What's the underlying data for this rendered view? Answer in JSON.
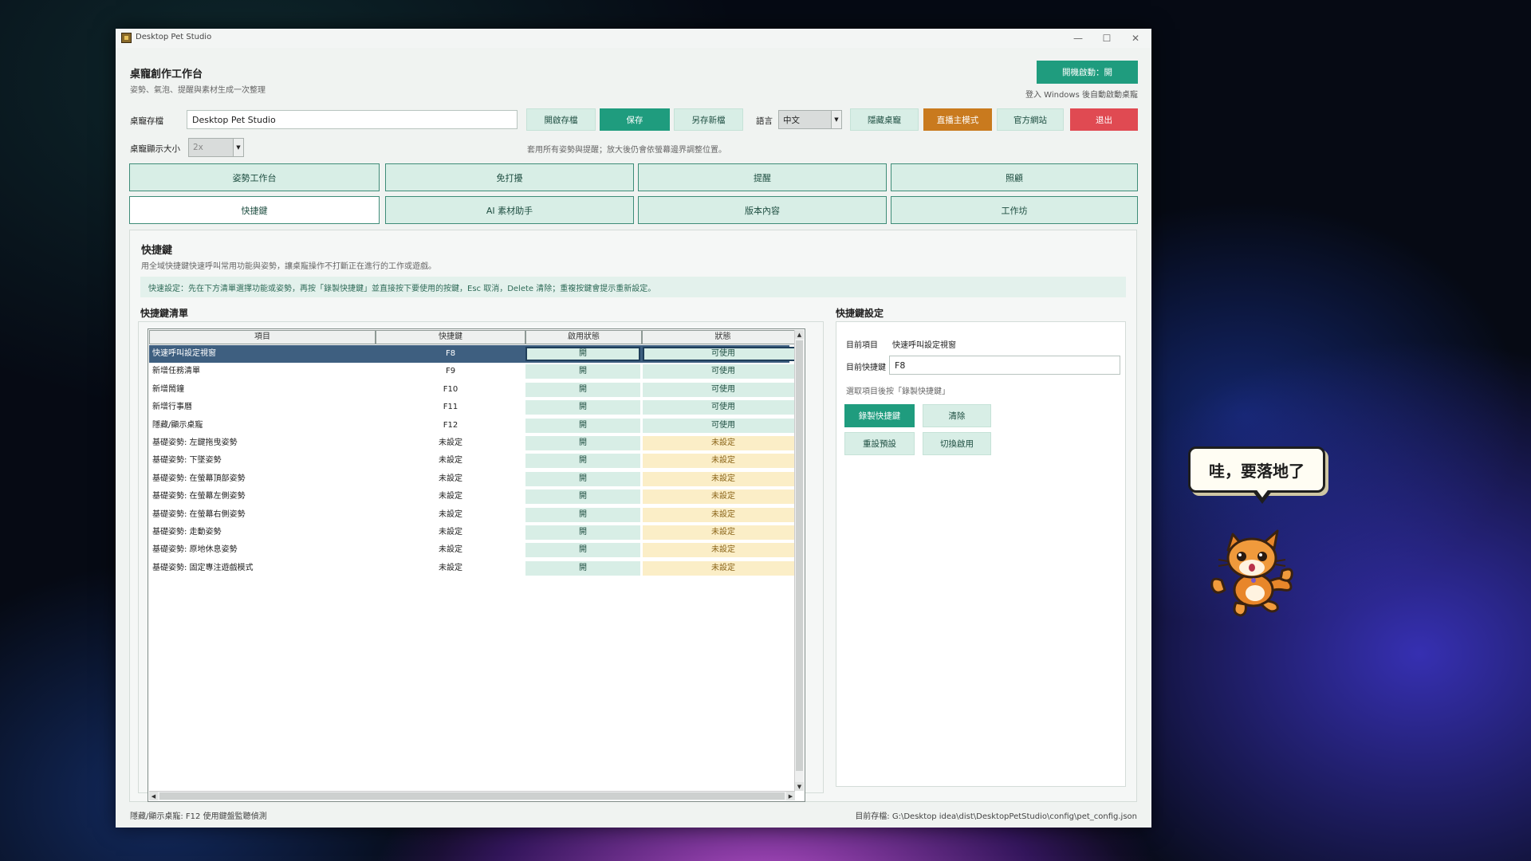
{
  "window": {
    "title": "Desktop Pet Studio"
  },
  "header": {
    "title": "桌寵創作工作台",
    "subtitle": "姿勢、氣泡、提醒與素材生成一次整理",
    "autostart_label": "開機啟動：開",
    "autostart_hint": "登入 Windows 後自動啟動桌寵"
  },
  "toolbar": {
    "profile_label": "桌寵存檔",
    "profile_value": "Desktop Pet Studio",
    "open_label": "開啟存檔",
    "save_label": "保存",
    "save_as_label": "另存新檔",
    "language_label": "語言",
    "language_value": "中文",
    "hide_label": "隱藏桌寵",
    "streamer_label": "直播主模式",
    "website_label": "官方網站",
    "exit_label": "退出",
    "size_label": "桌寵顯示大小",
    "size_value": "2x",
    "size_hint": "套用所有姿勢與提醒；放大後仍會依螢幕邊界調整位置。"
  },
  "tabs": [
    {
      "label": "姿勢工作台"
    },
    {
      "label": "免打擾"
    },
    {
      "label": "提醒"
    },
    {
      "label": "照顧"
    },
    {
      "label": "快捷鍵"
    },
    {
      "label": "AI 素材助手"
    },
    {
      "label": "版本內容"
    },
    {
      "label": "工作坊"
    }
  ],
  "hotkeys": {
    "title": "快捷鍵",
    "description": "用全域快捷鍵快速呼叫常用功能與姿勢，讓桌寵操作不打斷正在進行的工作或遊戲。",
    "hint": "快速設定：先在下方清單選擇功能或姿勢，再按「錄製快捷鍵」並直接按下要使用的按鍵，Esc 取消，Delete 清除；重複按鍵會提示重新設定。",
    "list_title": "快捷鍵清單",
    "columns": [
      "項目",
      "快捷鍵",
      "啟用狀態",
      "狀態"
    ],
    "rows": [
      {
        "name": "快速呼叫設定視窗",
        "key": "F8",
        "enabled": "開",
        "status": "可使用",
        "ok": true
      },
      {
        "name": "新增任務清單",
        "key": "F9",
        "enabled": "開",
        "status": "可使用",
        "ok": true
      },
      {
        "name": "新增鬧鐘",
        "key": "F10",
        "enabled": "開",
        "status": "可使用",
        "ok": true
      },
      {
        "name": "新增行事曆",
        "key": "F11",
        "enabled": "開",
        "status": "可使用",
        "ok": true
      },
      {
        "name": "隱藏/顯示桌寵",
        "key": "F12",
        "enabled": "開",
        "status": "可使用",
        "ok": true
      },
      {
        "name": "基礎姿勢: 左鍵拖曳姿勢",
        "key": "未設定",
        "enabled": "開",
        "status": "未設定",
        "ok": false
      },
      {
        "name": "基礎姿勢: 下墜姿勢",
        "key": "未設定",
        "enabled": "開",
        "status": "未設定",
        "ok": false
      },
      {
        "name": "基礎姿勢: 在螢幕頂部姿勢",
        "key": "未設定",
        "enabled": "開",
        "status": "未設定",
        "ok": false
      },
      {
        "name": "基礎姿勢: 在螢幕左側姿勢",
        "key": "未設定",
        "enabled": "開",
        "status": "未設定",
        "ok": false
      },
      {
        "name": "基礎姿勢: 在螢幕右側姿勢",
        "key": "未設定",
        "enabled": "開",
        "status": "未設定",
        "ok": false
      },
      {
        "name": "基礎姿勢: 走動姿勢",
        "key": "未設定",
        "enabled": "開",
        "status": "未設定",
        "ok": false
      },
      {
        "name": "基礎姿勢: 原地休息姿勢",
        "key": "未設定",
        "enabled": "開",
        "status": "未設定",
        "ok": false
      },
      {
        "name": "基礎姿勢: 固定專注遊戲模式",
        "key": "未設定",
        "enabled": "開",
        "status": "未設定",
        "ok": false
      }
    ],
    "settings": {
      "title": "快捷鍵設定",
      "current_item_label": "目前項目",
      "current_item_value": "快速呼叫設定視窗",
      "current_key_label": "目前快捷鍵",
      "current_key_value": "F8",
      "instruction": "選取項目後按「錄製快捷鍵」",
      "record_label": "錄製快捷鍵",
      "clear_label": "清除",
      "reset_label": "重設預設",
      "toggle_label": "切換啟用"
    }
  },
  "statusbar": {
    "left": "隱藏/顯示桌寵: F12 使用鍵盤監聽偵測",
    "right": "目前存檔: G:\\Desktop idea\\dist\\DesktopPetStudio\\config\\pet_config.json"
  },
  "pet": {
    "speech": "哇，要落地了"
  }
}
